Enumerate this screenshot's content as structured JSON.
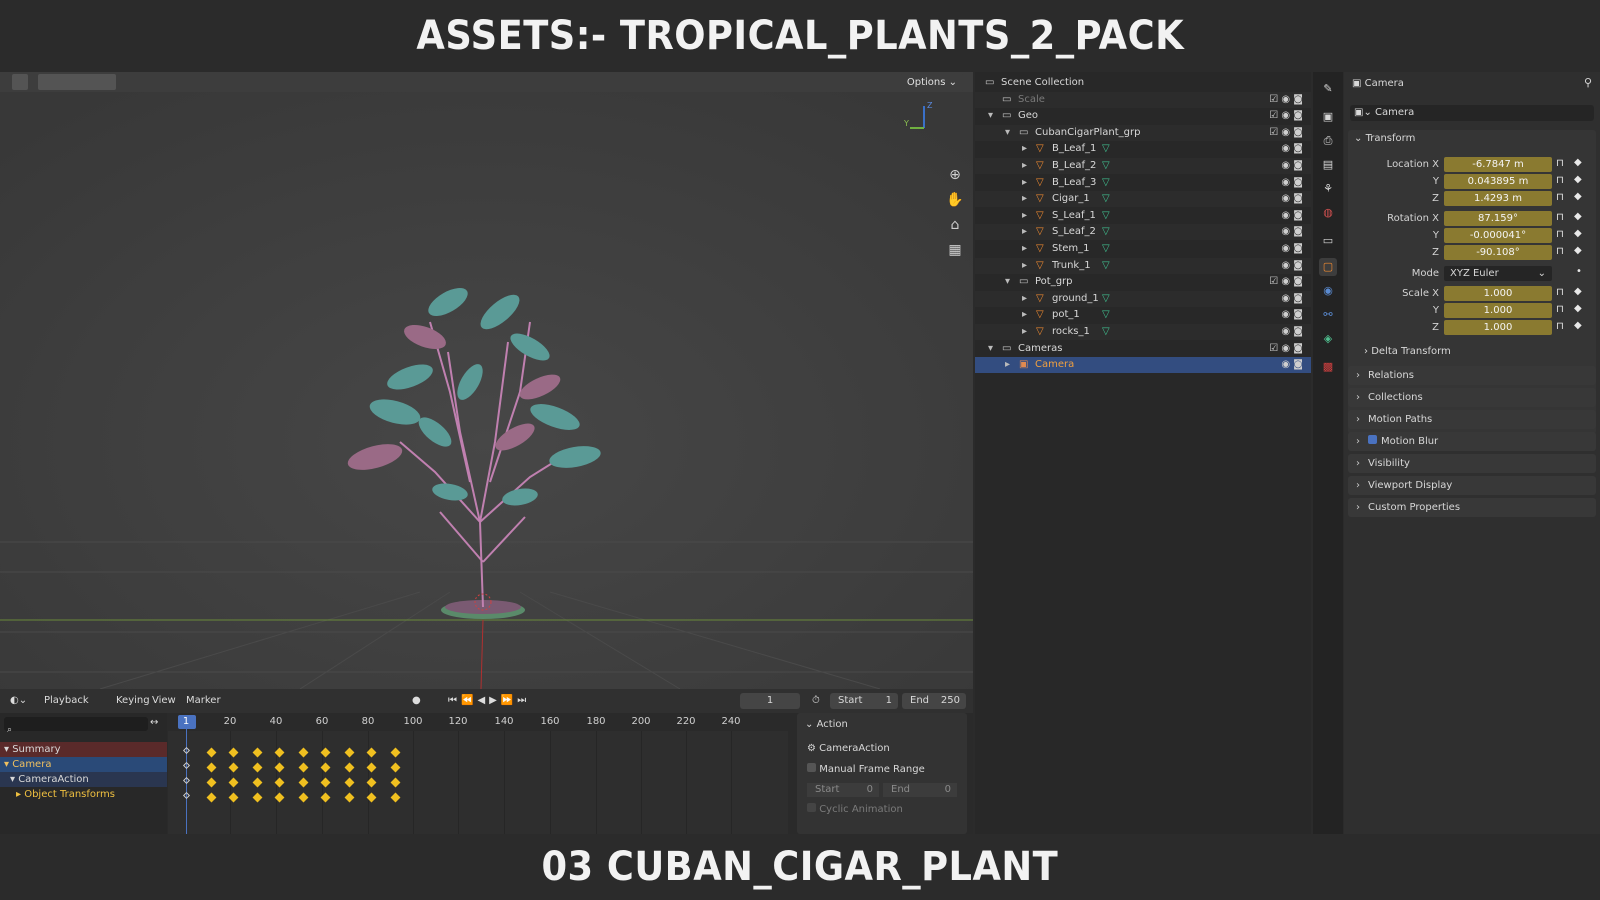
{
  "banner": {
    "top": "ASSETS:- TROPICAL_PLANTS_2_PACK",
    "bottom": "03 CUBAN_CIGAR_PLANT"
  },
  "viewport": {
    "options_label": "Options",
    "gizmo_z": "Z",
    "gizmo_y": "Y",
    "nav_icons": [
      "zoom-icon",
      "hand-icon",
      "camera-icon",
      "grid-icon"
    ]
  },
  "timeline": {
    "menus": [
      "Playback",
      "Keying",
      "View",
      "Marker"
    ],
    "current_frame": "1",
    "start_label": "Start",
    "start_value": "1",
    "end_label": "End",
    "end_value": "250",
    "ticks": [
      "1",
      "20",
      "40",
      "60",
      "80",
      "100",
      "120",
      "140",
      "160",
      "180",
      "200",
      "220",
      "240"
    ],
    "channels": [
      "Summary",
      "Camera",
      "CameraAction",
      "Object Transforms"
    ],
    "action_panel": {
      "title": "Action",
      "action_name": "CameraAction",
      "manual_frame_range": "Manual Frame Range",
      "start_label": "Start",
      "start_value": "0",
      "end_label": "End",
      "end_value": "0",
      "cyclic": "Cyclic Animation"
    }
  },
  "outliner": {
    "rows": [
      {
        "label": "Scene Collection",
        "indent": 0
      },
      {
        "label": "Scale",
        "indent": 1
      },
      {
        "label": "Geo",
        "indent": 1
      },
      {
        "label": "CubanCigarPlant_grp",
        "indent": 2
      },
      {
        "label": "B_Leaf_1",
        "indent": 3
      },
      {
        "label": "B_Leaf_2",
        "indent": 3
      },
      {
        "label": "B_Leaf_3",
        "indent": 3
      },
      {
        "label": "Cigar_1",
        "indent": 3
      },
      {
        "label": "S_Leaf_1",
        "indent": 3
      },
      {
        "label": "S_Leaf_2",
        "indent": 3
      },
      {
        "label": "Stem_1",
        "indent": 3
      },
      {
        "label": "Trunk_1",
        "indent": 3
      },
      {
        "label": "Pot_grp",
        "indent": 2
      },
      {
        "label": "ground_1",
        "indent": 3
      },
      {
        "label": "pot_1",
        "indent": 3
      },
      {
        "label": "rocks_1",
        "indent": 3
      },
      {
        "label": "Cameras",
        "indent": 1
      },
      {
        "label": "Camera",
        "indent": 2
      }
    ]
  },
  "properties": {
    "header_title": "Camera",
    "object_name": "Camera",
    "transform_title": "Transform",
    "location": {
      "label_x": "Location X",
      "x": "-6.7847 m",
      "label_y": "Y",
      "y": "0.043895 m",
      "label_z": "Z",
      "z": "1.4293 m"
    },
    "rotation": {
      "label_x": "Rotation X",
      "x": "87.159°",
      "label_y": "Y",
      "y": "-0.000041°",
      "label_z": "Z",
      "z": "-90.108°"
    },
    "mode_label": "Mode",
    "mode_value": "XYZ Euler",
    "scale": {
      "label_x": "Scale X",
      "x": "1.000",
      "label_y": "Y",
      "y": "1.000",
      "label_z": "Z",
      "z": "1.000"
    },
    "delta_transform": "Delta Transform",
    "sections": [
      "Relations",
      "Collections",
      "Motion Paths",
      "Motion Blur",
      "Visibility",
      "Viewport Display",
      "Custom Properties"
    ]
  },
  "colors": {
    "accent_selected": "#334d80",
    "keyframe": "#f0c020",
    "field_animated": "#8a7a30",
    "leaf_teal": "#5a9a96",
    "leaf_pink": "#9a6a86"
  }
}
